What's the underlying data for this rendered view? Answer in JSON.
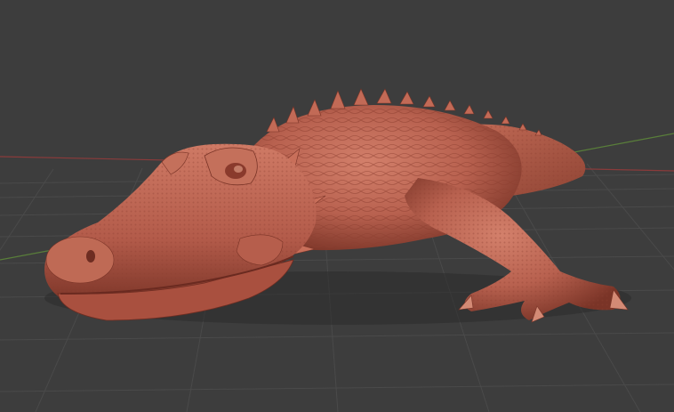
{
  "viewport": {
    "background": "#3d3d3d",
    "grid_color": "#4a4a4a",
    "axis_x_color": "#8a3b3b",
    "axis_y_color": "#5f8a3a"
  },
  "model": {
    "material": "clay",
    "base_color": "#b8614f",
    "shadow_color": "#6e2d22",
    "highlight_color": "#d98873"
  }
}
